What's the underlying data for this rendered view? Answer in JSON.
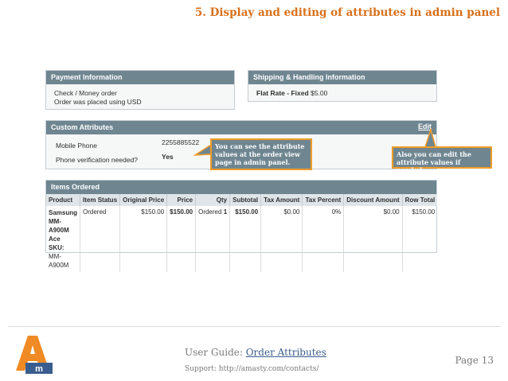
{
  "heading": "5. Display and editing of attributes in admin panel",
  "payment": {
    "title": "Payment Information",
    "lines": [
      "Check / Money order",
      "Order was placed using USD"
    ]
  },
  "shipping": {
    "title": "Shipping & Handling Information",
    "method": "Flat Rate - Fixed",
    "price": "$5.00"
  },
  "custom_attributes": {
    "title": "Custom Attributes",
    "edit_label": "Edit",
    "rows": [
      {
        "label": "Mobile Phone",
        "value": "2255885522"
      },
      {
        "label": "Phone verification needed?",
        "value": "Yes"
      }
    ]
  },
  "callouts": {
    "left": "You can see the attribute values at the order view page in admin panel.",
    "right": "Also you can edit the attribute values if needed."
  },
  "items_ordered": {
    "title": "Items Ordered",
    "columns": [
      "Product",
      "Item Status",
      "Original Price",
      "Price",
      "Qty",
      "Subtotal",
      "Tax Amount",
      "Tax Percent",
      "Discount Amount",
      "Row Total"
    ],
    "row": {
      "product_name": [
        "Samsung",
        "MM-A900M",
        "Ace"
      ],
      "sku_label": "SKU:",
      "sku_value": "MM-A900M",
      "item_status": "Ordered",
      "original_price": "$150.00",
      "price": "$150.00",
      "qty_label": "Ordered",
      "qty_value": "1",
      "subtotal": "$150.00",
      "tax_amount": "$0.00",
      "tax_percent": "0%",
      "discount_amount": "$0.00",
      "row_total": "$150.00"
    }
  },
  "footer": {
    "guide_prefix": "User Guide: ",
    "guide_link": "Order Attributes",
    "support": "Support: http://amasty.com/contacts/",
    "page": "Page 13"
  },
  "colors": {
    "heading": "#d8701a",
    "panel_header": "#6f8691",
    "callout_border": "#f29c25",
    "logo_orange": "#f08a24",
    "logo_blue": "#3a5d8f"
  }
}
